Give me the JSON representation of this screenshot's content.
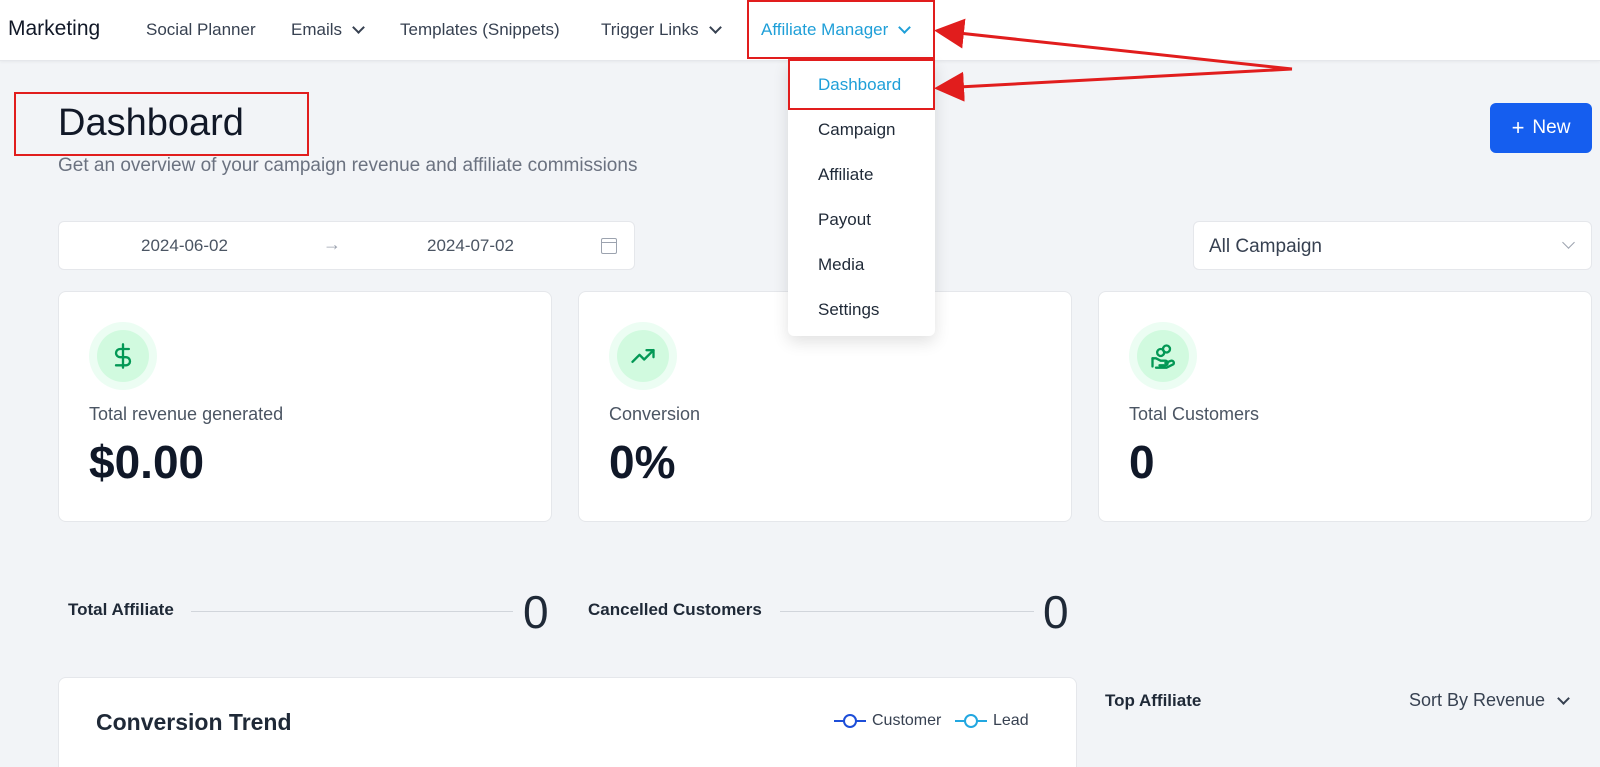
{
  "nav": {
    "brand": "Marketing",
    "items": [
      {
        "label": "Social Planner"
      },
      {
        "label": "Emails"
      },
      {
        "label": "Templates (Snippets)"
      },
      {
        "label": "Trigger Links"
      },
      {
        "label": "Affiliate Manager"
      }
    ],
    "active_color": "#1f9fd8"
  },
  "dropdown": {
    "items": [
      {
        "label": "Dashboard"
      },
      {
        "label": "Campaign"
      },
      {
        "label": "Affiliate"
      },
      {
        "label": "Payout"
      },
      {
        "label": "Media"
      },
      {
        "label": "Settings"
      }
    ]
  },
  "header": {
    "title": "Dashboard",
    "subtitle": "Get an overview of your campaign revenue and affiliate commissions",
    "new_label": "New"
  },
  "filters": {
    "start_date": "2024-06-02",
    "end_date": "2024-07-02",
    "campaign": "All Campaign"
  },
  "stats": [
    {
      "label": "Total revenue generated",
      "value": "$0.00",
      "icon": "dollar-icon"
    },
    {
      "label": "Conversion",
      "value": "0%",
      "icon": "trending-up-icon"
    },
    {
      "label": "Total Customers",
      "value": "0",
      "icon": "hand-coins-icon"
    }
  ],
  "counters": [
    {
      "label": "Total Affiliate",
      "value": "0"
    },
    {
      "label": "Cancelled Customers",
      "value": "0"
    }
  ],
  "trend": {
    "title": "Conversion Trend",
    "legend": [
      {
        "label": "Customer",
        "color": "#1d4ed8"
      },
      {
        "label": "Lead",
        "color": "#22a7e0"
      }
    ]
  },
  "top_affiliate": {
    "title": "Top Affiliate",
    "sort_label": "Sort By Revenue"
  },
  "colors": {
    "primary": "#155eef",
    "annotation": "#e11d1d",
    "success": "#039855"
  }
}
